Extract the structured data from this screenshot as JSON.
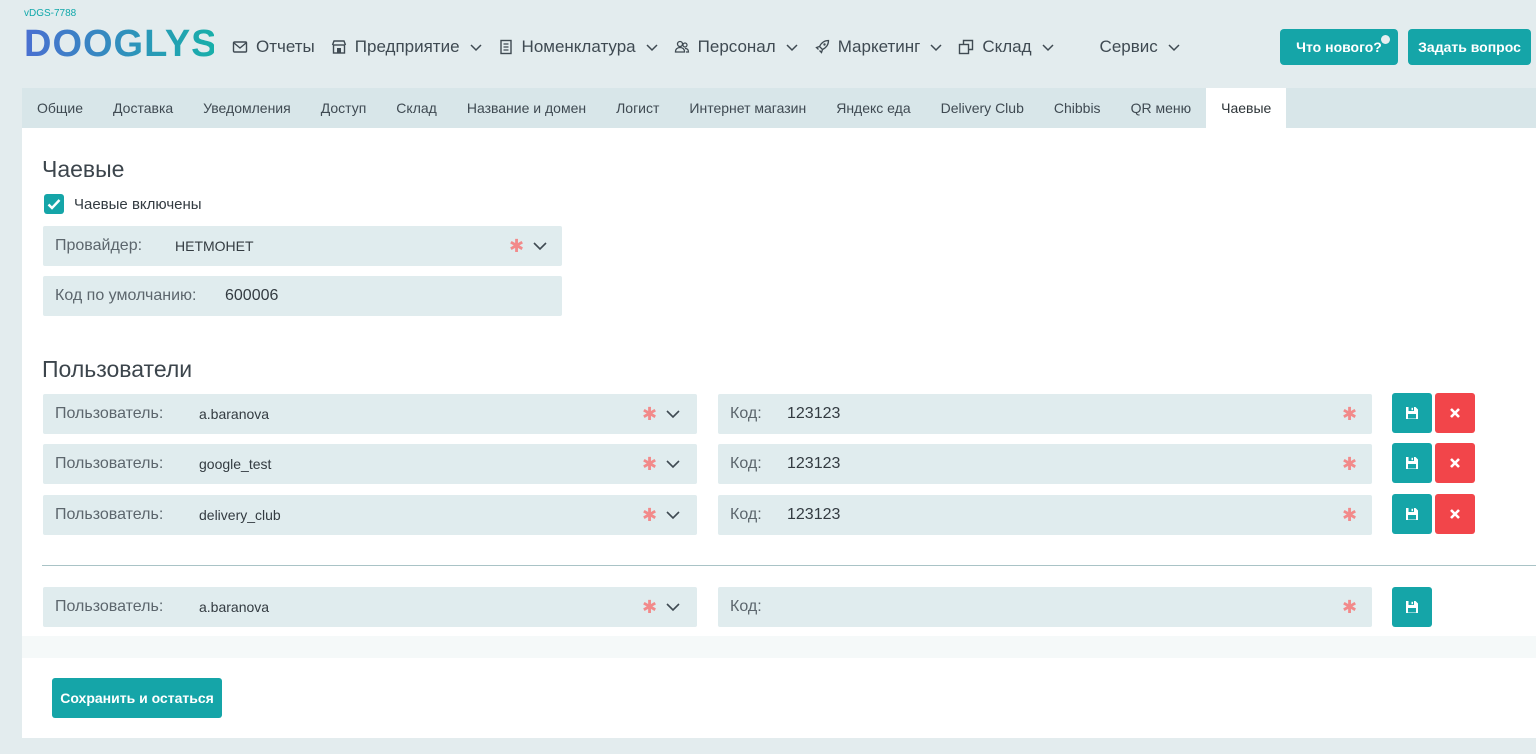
{
  "app": {
    "version": "vDGS-7788",
    "logo_text": "DOOGLYS"
  },
  "nav": {
    "items": [
      {
        "label": "Отчеты",
        "icon": "mail-icon",
        "has_dropdown": false
      },
      {
        "label": "Предприятие",
        "icon": "store-icon",
        "has_dropdown": true
      },
      {
        "label": "Номенклатура",
        "icon": "document-icon",
        "has_dropdown": true
      },
      {
        "label": "Персонал",
        "icon": "people-icon",
        "has_dropdown": true
      },
      {
        "label": "Маркетинг",
        "icon": "rocket-icon",
        "has_dropdown": true
      },
      {
        "label": "Склад",
        "icon": "copy-icon",
        "has_dropdown": true
      },
      {
        "label": "Сервис",
        "icon": "",
        "has_dropdown": true
      }
    ],
    "whats_new": "Что нового?",
    "ask_question": "Задать вопрос"
  },
  "tabs": [
    {
      "label": "Общие",
      "active": false
    },
    {
      "label": "Доставка",
      "active": false
    },
    {
      "label": "Уведомления",
      "active": false
    },
    {
      "label": "Доступ",
      "active": false
    },
    {
      "label": "Склад",
      "active": false
    },
    {
      "label": "Название и домен",
      "active": false
    },
    {
      "label": "Логист",
      "active": false
    },
    {
      "label": "Интернет магазин",
      "active": false
    },
    {
      "label": "Яндекс еда",
      "active": false
    },
    {
      "label": "Delivery Club",
      "active": false
    },
    {
      "label": "Chibbis",
      "active": false
    },
    {
      "label": "QR меню",
      "active": false
    },
    {
      "label": "Чаевые",
      "active": true
    }
  ],
  "tips": {
    "title": "Чаевые",
    "enabled_label": "Чаевые включены",
    "enabled": true,
    "provider_label": "Провайдер:",
    "provider_value": "НЕТМОНЕТ",
    "default_code_label": "Код по умолчанию:",
    "default_code_value": "600006"
  },
  "users": {
    "title": "Пользователи",
    "user_label": "Пользователь:",
    "code_label": "Код:",
    "rows": [
      {
        "user": "a.baranova",
        "code": "123123"
      },
      {
        "user": "google_test",
        "code": "123123"
      },
      {
        "user": "delivery_club",
        "code": "123123"
      }
    ],
    "new_row": {
      "user": "a.baranova",
      "code": ""
    }
  },
  "actions": {
    "save_and_stay": "Сохранить и остаться"
  },
  "colors": {
    "accent": "#15a5a8",
    "danger": "#f2454a",
    "field_bg": "#e0ecee",
    "page_bg": "#e3ecee"
  }
}
